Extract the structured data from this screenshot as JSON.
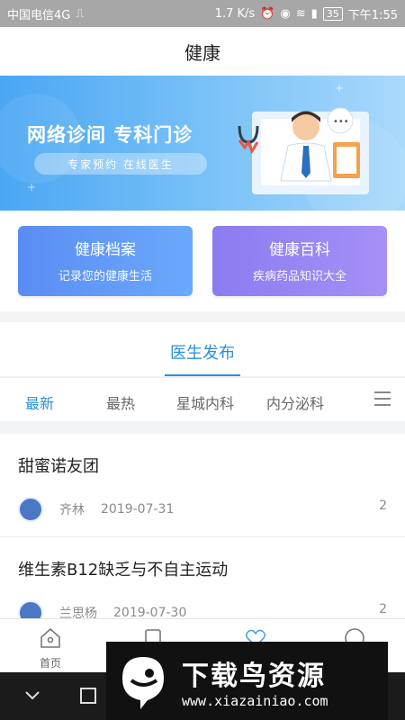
{
  "status_bar": {
    "carrier": "中国电信4G",
    "usb_icon": "usb-icon",
    "speed": "1.7 K/s",
    "battery": "35",
    "time": "下午1:55"
  },
  "title": "健康",
  "banner": {
    "headline": "网络诊间  专科门诊",
    "subline": "专家预约  在线医生"
  },
  "cards": [
    {
      "title": "健康档案",
      "subtitle": "记录您的健康生活",
      "color": "#5a8df3"
    },
    {
      "title": "健康百科",
      "subtitle": "疾病药品知识大全",
      "color": "#8a7cf0"
    }
  ],
  "section": {
    "title": "医生发布"
  },
  "tabs": [
    "最新",
    "最热",
    "星城内科",
    "内分泌科"
  ],
  "posts": [
    {
      "title": "甜蜜诺友团",
      "author": "齐林",
      "date": "2019-07-31",
      "count": "2"
    },
    {
      "title": "维生素B12缺乏与不自主运动",
      "author": "兰思杨",
      "date": "2019-07-30",
      "count": "2"
    }
  ],
  "bottom_nav": {
    "home": "首页"
  },
  "watermark": {
    "brand": "下载鸟资源",
    "url": "www.xiazainiao.com"
  },
  "colors": {
    "accent": "#2b8fdc",
    "banner": "#4aa7f3"
  }
}
